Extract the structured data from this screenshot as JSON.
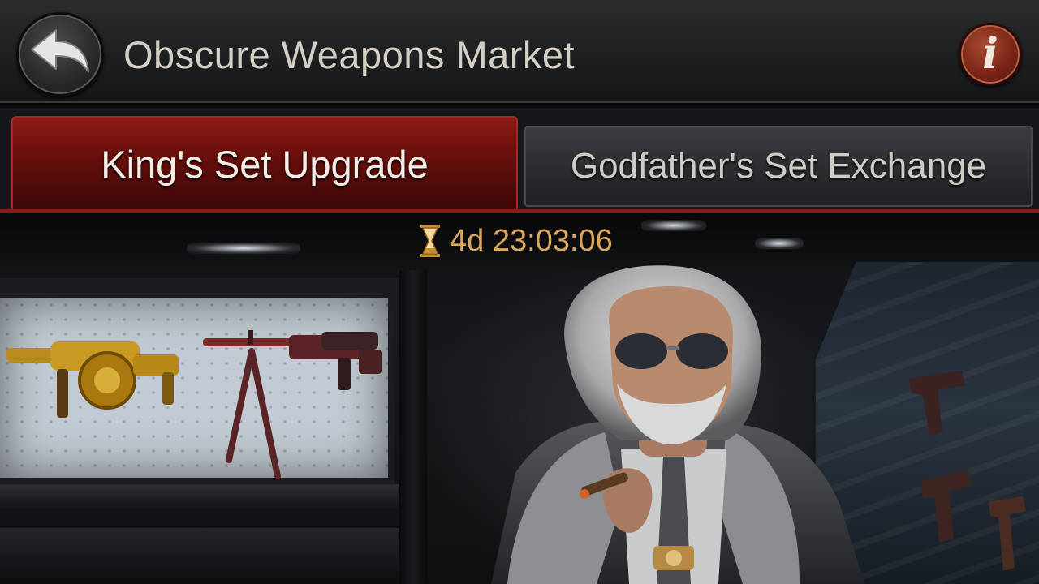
{
  "header": {
    "title": "Obscure Weapons Market",
    "back_icon": "back-arrow-icon",
    "info_icon": "info-icon",
    "info_label": "i"
  },
  "tabs": [
    {
      "label": "King's Set Upgrade",
      "active": true
    },
    {
      "label": "Godfather's Set Exchange",
      "active": false
    }
  ],
  "event": {
    "timer_icon": "hourglass-icon",
    "countdown": "4d 23:03:06"
  },
  "colors": {
    "accent_red": "#8e1a16",
    "timer_gold": "#dba75a",
    "title_text": "#d4cfc4"
  }
}
